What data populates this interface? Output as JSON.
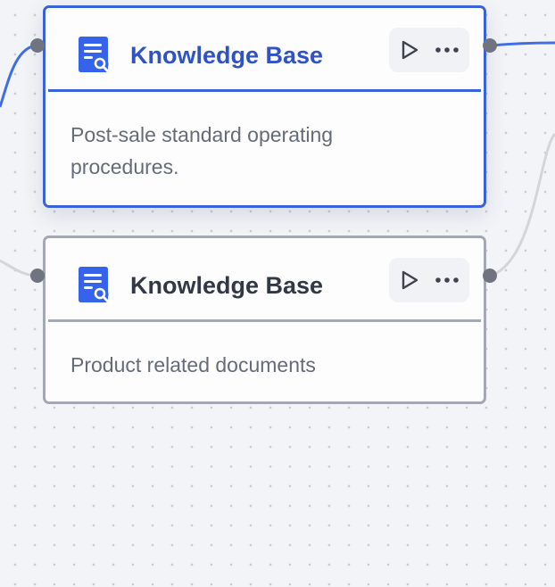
{
  "canvas": {
    "background": "#f3f4f7",
    "dot_color": "#c8cbd3"
  },
  "nodes": [
    {
      "title": "Knowledge Base",
      "description": "Post-sale standard operating procedures.",
      "icon": "knowledge-base-search-icon",
      "state": "selected",
      "accent": "#3b63d9"
    },
    {
      "title": "Knowledge Base",
      "description": "Product related documents",
      "icon": "knowledge-base-search-icon",
      "state": "default",
      "accent": "#a3a8b3"
    }
  ],
  "actions": {
    "run_icon": "play-icon",
    "more_icon": "more-horizontal-icon"
  },
  "colors": {
    "active_edge": "#3f6ee6",
    "inactive_edge": "#d3d5da",
    "port": "#6f7480",
    "icon_blue": "#3563e9"
  }
}
